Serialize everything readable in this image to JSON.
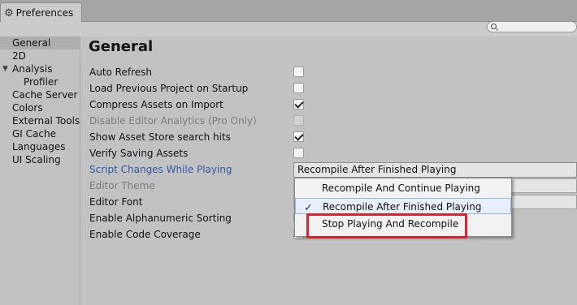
{
  "window": {
    "tab_title": "Preferences",
    "tab_icon": "gear-icon"
  },
  "search": {
    "placeholder": "",
    "icon": "search-icon"
  },
  "sidebar": {
    "items": [
      {
        "label": "General",
        "selected": true
      },
      {
        "label": "2D"
      },
      {
        "label": "Analysis",
        "expanded": true
      },
      {
        "label": "Profiler",
        "child": true
      },
      {
        "label": "Cache Server ("
      },
      {
        "label": "Colors"
      },
      {
        "label": "External Tools"
      },
      {
        "label": "GI Cache"
      },
      {
        "label": "Languages"
      },
      {
        "label": "UI Scaling"
      }
    ]
  },
  "main": {
    "title": "General",
    "settings": [
      {
        "label": "Auto Refresh",
        "checked": false
      },
      {
        "label": "Load Previous Project on Startup",
        "checked": false
      },
      {
        "label": "Compress Assets on Import",
        "checked": true
      },
      {
        "label": "Disable Editor Analytics (Pro Only)",
        "checked": false,
        "disabled": true
      },
      {
        "label": "Show Asset Store search hits",
        "checked": true
      },
      {
        "label": "Verify Saving Assets",
        "checked": false
      },
      {
        "label": "Script Changes While Playing",
        "value": "Recompile After Finished Playing"
      },
      {
        "label": "Editor Theme",
        "disabled": true
      },
      {
        "label": "Editor Font"
      },
      {
        "label": "Enable Alphanumeric Sorting"
      },
      {
        "label": "Enable Code Coverage"
      }
    ]
  },
  "dropdown": {
    "options": [
      {
        "label": "Recompile And Continue Playing",
        "selected": false
      },
      {
        "label": "Recompile After Finished Playing",
        "selected": true
      },
      {
        "label": "Stop Playing And Recompile",
        "selected": false
      }
    ]
  },
  "colors": {
    "highlight": "#e0202a",
    "link_text": "#2c5aa0"
  }
}
